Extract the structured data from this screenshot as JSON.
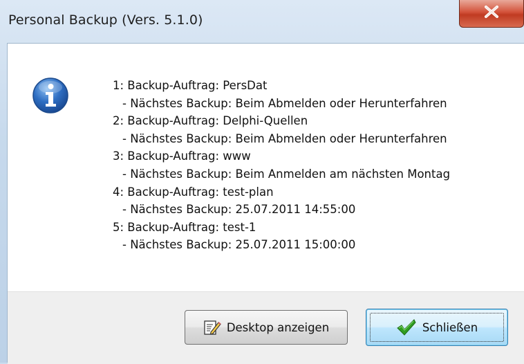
{
  "window": {
    "title": "Personal Backup (Vers. 5.1.0)"
  },
  "dialog": {
    "icon": "info-icon",
    "lines": [
      "1: Backup-Auftrag: PersDat",
      "- Nächstes Backup: Beim Abmelden oder Herunterfahren",
      "2: Backup-Auftrag: Delphi-Quellen",
      "- Nächstes Backup: Beim Abmelden oder Herunterfahren",
      "3: Backup-Auftrag: www",
      "- Nächstes Backup: Beim Anmelden am nächsten Montag",
      "4: Backup-Auftrag: test-plan",
      "- Nächstes Backup: 25.07.2011 14:55:00",
      "5: Backup-Auftrag: test-1",
      "- Nächstes Backup: 25.07.2011 15:00:00"
    ]
  },
  "buttons": {
    "desktop_label": "Desktop anzeigen",
    "desktop_icon": "notepad-pencil-icon",
    "close_label": "Schließen",
    "close_icon": "green-checkmark-icon"
  },
  "colors": {
    "title_frame": "#c6d9ec",
    "close_button": "#c03b22",
    "footer": "#efefef",
    "info_icon": "#2a67b8",
    "checkmark": "#2f9d1f"
  }
}
